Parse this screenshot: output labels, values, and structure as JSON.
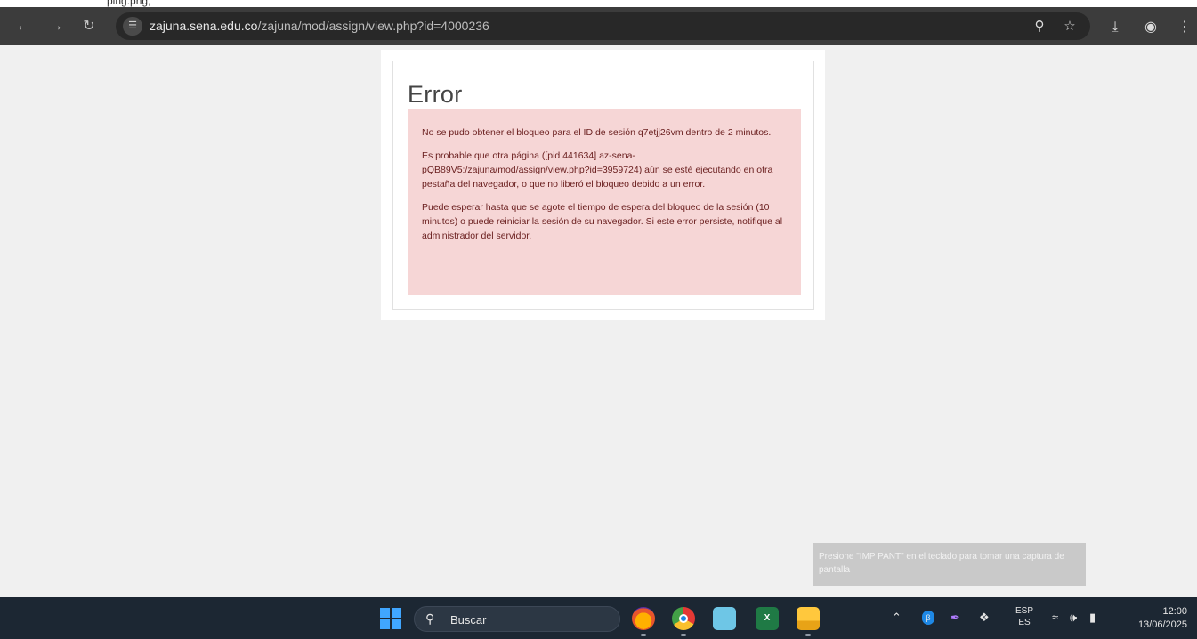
{
  "browser": {
    "top_cut_text": "ping.png,",
    "url_host": "zajuna.sena.edu.co",
    "url_path": "/zajuna/mod/assign/view.php?id=4000236",
    "nav_icons": [
      "back-arrow-icon",
      "forward-arrow-icon",
      "reload-icon"
    ],
    "omnibox_icons": [
      "zoom-icon",
      "bookmark-star-icon"
    ],
    "toolbar_icons": [
      "download-icon",
      "profile-icon",
      "menu-kebab-icon"
    ]
  },
  "page": {
    "title": "Error",
    "messages": [
      "No se pudo obtener el bloqueo para el ID de sesión q7etjj26vm dentro de 2 minutos.",
      "Es probable que otra página ([pid 441634] az-sena-pQB89V5:/zajuna/mod/assign/view.php?id=3959724) aún se esté ejecutando en otra pestaña del navegador, o que no liberó el bloqueo debido a un error.",
      "Puede esperar hasta que se agote el tiempo de espera del bloqueo de la sesión (10 minutos) o puede reiniciar la sesión de su navegador. Si este error persiste, notifique al administrador del servidor."
    ],
    "alert_bg": "#f6d6d6",
    "alert_text_color": "#6b2020"
  },
  "toast": {
    "text": "Presione \"IMP PANT\" en el teclado para tomar una captura de pantalla"
  },
  "taskbar": {
    "search_label": "Buscar",
    "apps": [
      "firefox-icon",
      "chrome-icon",
      "photos-icon",
      "excel-icon",
      "file-explorer-icon"
    ],
    "lang_top": "ESP",
    "lang_bottom": "ES",
    "time": "12:00",
    "date": "13/06/2025"
  }
}
